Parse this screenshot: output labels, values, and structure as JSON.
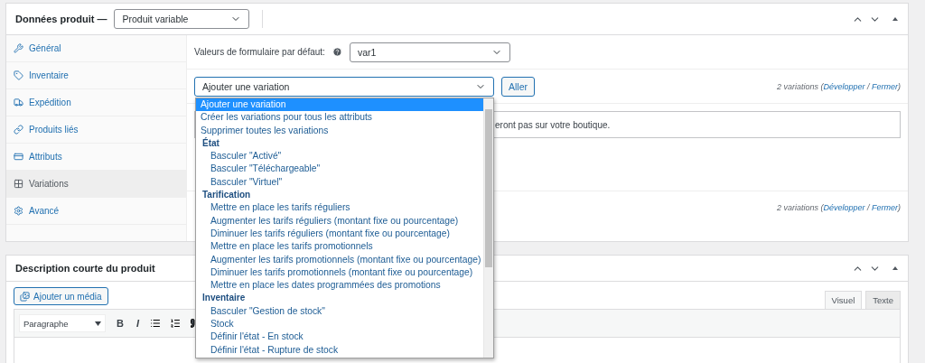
{
  "product_data": {
    "title": "Données produit —",
    "type_select": {
      "value": "Produit variable"
    },
    "tabs": [
      {
        "label": "Général",
        "selected": false
      },
      {
        "label": "Inventaire",
        "selected": false
      },
      {
        "label": "Expédition",
        "selected": false
      },
      {
        "label": "Produits liés",
        "selected": false
      },
      {
        "label": "Attributs",
        "selected": false
      },
      {
        "label": "Variations",
        "selected": true
      },
      {
        "label": "Avancé",
        "selected": false
      }
    ],
    "default_values": {
      "label": "Valeurs de formulaire par défaut:",
      "value": "var1"
    },
    "variation_select": {
      "value": "Ajouter une variation",
      "button": "Aller",
      "options": [
        {
          "kind": "option",
          "label": "Ajouter une variation",
          "selected": true
        },
        {
          "kind": "option",
          "label": "Créer les variations pour tous les attributs",
          "selected": false
        },
        {
          "kind": "option",
          "label": "Supprimer toutes les variations",
          "selected": false
        },
        {
          "kind": "group",
          "label": "État",
          "children": [
            {
              "label": "Basculer \"Activé\"",
              "selected": false
            },
            {
              "label": "Basculer \"Téléchargeable\"",
              "selected": false
            },
            {
              "label": "Basculer \"Virtuel\"",
              "selected": false
            }
          ]
        },
        {
          "kind": "group",
          "label": "Tarification",
          "children": [
            {
              "label": "Mettre en place les tarifs réguliers",
              "selected": false
            },
            {
              "label": "Augmenter les tarifs réguliers (montant fixe ou pourcentage)",
              "selected": false
            },
            {
              "label": "Diminuer les tarifs réguliers (montant fixe ou pourcentage)",
              "selected": false
            },
            {
              "label": "Mettre en place les tarifs promotionnels",
              "selected": false
            },
            {
              "label": "Augmenter les tarifs promotionnels (montant fixe ou pourcentage)",
              "selected": false
            },
            {
              "label": "Diminuer les tarifs promotionnels (montant fixe ou pourcentage)",
              "selected": false
            },
            {
              "label": "Mettre en place les dates programmées des promotions",
              "selected": false
            }
          ]
        },
        {
          "kind": "group",
          "label": "Inventaire",
          "children": [
            {
              "label": "Basculer \"Gestion de stock\"",
              "selected": false
            },
            {
              "label": "Stock",
              "selected": false
            },
            {
              "label": "Définir l'état - En stock",
              "selected": false
            },
            {
              "label": "Définir l'état - Rupture de stock",
              "selected": false
            }
          ]
        }
      ]
    },
    "summaries": [
      {
        "before": "2 variations (",
        "expand": "Développer",
        "separator": " / ",
        "collapse": "Fermer",
        "after": ")"
      },
      {
        "before": "2 variations (",
        "expand": "Développer",
        "separator": " / ",
        "collapse": "Fermer",
        "after": ")"
      }
    ],
    "notice": "eront pas sur votre boutique."
  },
  "short_description": {
    "title": "Description courte du produit",
    "media_button": "Ajouter un média",
    "editor_tabs": [
      {
        "label": "Visuel",
        "selected": true
      },
      {
        "label": "Texte",
        "selected": false
      }
    ],
    "format_select": {
      "value": "Paragraphe"
    },
    "bold": "B",
    "italic": "I"
  }
}
